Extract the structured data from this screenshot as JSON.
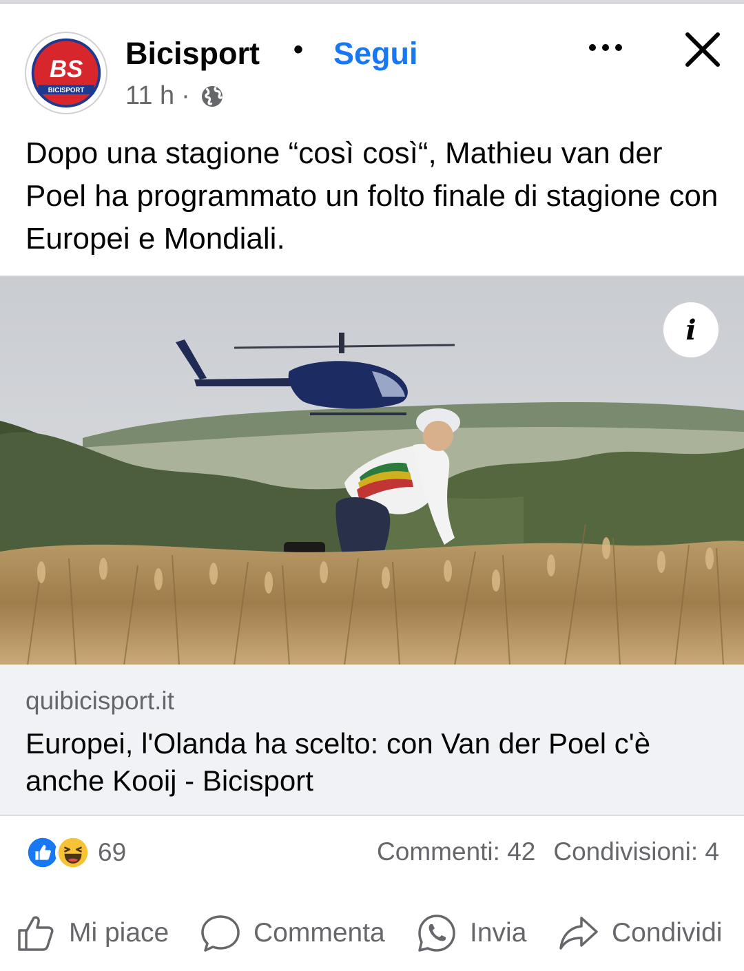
{
  "header": {
    "page_name": "Bicisport",
    "separator": "•",
    "follow_label": "Segui",
    "time": "11 h",
    "meta_separator": "·",
    "privacy_icon": "globe-icon",
    "more_icon": "more-icon",
    "close_icon": "close-icon",
    "avatar": {
      "logo_text": "BS",
      "logo_subtext": "BICISPORT",
      "brand_color": "#d8262d"
    }
  },
  "post": {
    "caption": "Dopo una stagione “così così“, Mathieu van der Poel ha programmato un folto finale di stagione con Europei e Mondiali."
  },
  "image": {
    "info_label": "i"
  },
  "link": {
    "domain": "quibicisport.it",
    "title": "Europei, l'Olanda ha scelto: con Van der Poel c'è anche Kooij - Bicisport"
  },
  "engagement": {
    "reaction_icons": [
      "like-reaction-icon",
      "haha-reaction-icon"
    ],
    "reaction_count": "69",
    "comments": "Commenti: 42",
    "shares": "Condivisioni: 4"
  },
  "actions": {
    "like": "Mi piace",
    "comment": "Commenta",
    "send": "Invia",
    "share": "Condividi"
  },
  "colors": {
    "accent": "#1877f2",
    "secondary_text": "#65676b",
    "link_background": "#f0f2f5"
  }
}
